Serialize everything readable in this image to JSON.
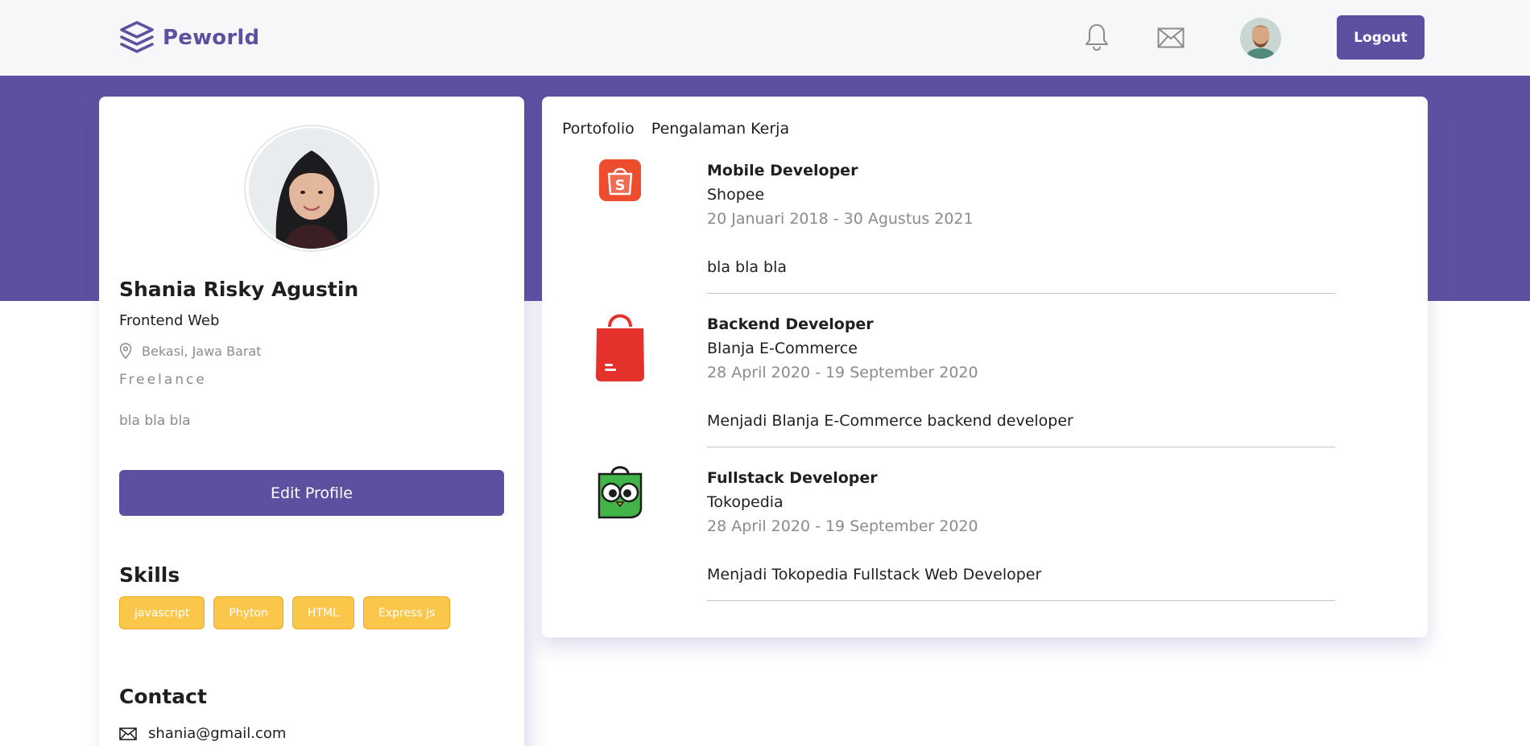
{
  "colors": {
    "brand": "#5e50a1",
    "chip": "#fbc74a",
    "chip_border": "#f0a821",
    "muted": "#8b8b8b"
  },
  "navbar": {
    "brand_name": "Peworld",
    "icons": [
      "layers-logo-icon",
      "bell-icon",
      "mail-icon"
    ],
    "logout_label": "Logout"
  },
  "profile": {
    "name": "Shania Risky Agustin",
    "job": "Frontend Web",
    "location": "Bekasi, Jawa Barat",
    "status": "Freelance",
    "description": "bla bla bla",
    "edit_label": "Edit Profile",
    "skills_title": "Skills",
    "skills": [
      "javascript",
      "Phyton",
      "HTML",
      "Express js"
    ],
    "contact_title": "Contact",
    "email": "shania@gmail.com"
  },
  "tabs": [
    "Portofolio",
    "Pengalaman Kerja"
  ],
  "experiences": [
    {
      "position": "Mobile Developer",
      "company": "Shopee",
      "date": "20 Januari 2018 - 30 Agustus 2021",
      "description": "bla bla bla",
      "logo": "shopee-logo-icon"
    },
    {
      "position": "Backend Developer",
      "company": "Blanja E-Commerce",
      "date": "28 April 2020 - 19 September 2020",
      "description": "Menjadi Blanja E-Commerce backend developer",
      "logo": "blanja-logo-icon"
    },
    {
      "position": "Fullstack Developer",
      "company": "Tokopedia",
      "date": "28 April 2020 - 19 September 2020",
      "description": "Menjadi Tokopedia Fullstack Web Developer",
      "logo": "tokopedia-logo-icon"
    }
  ]
}
